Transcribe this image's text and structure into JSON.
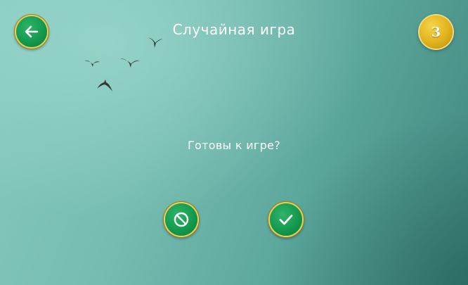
{
  "header": {
    "title": "Случайная игра",
    "coins": "3"
  },
  "main": {
    "prompt": "Готовы к игре?"
  },
  "icons": {
    "back": "arrow-left-icon",
    "cancel": "prohibited-icon",
    "confirm": "checkmark-icon",
    "coin": "coin-icon",
    "birds": "bird-icon"
  },
  "colors": {
    "button_green": "#139a4e",
    "button_rim": "#e9d25c",
    "coin_gold": "#e1b21c",
    "text": "#ffffff",
    "background": "#76bcb1"
  }
}
